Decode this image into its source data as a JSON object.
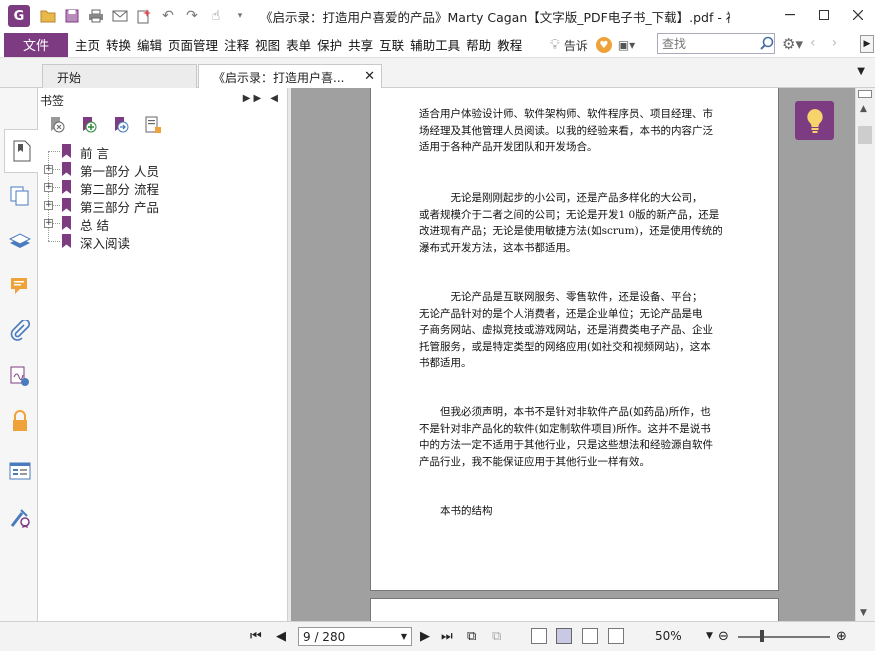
{
  "titlebar": {
    "app_logo": "G",
    "title": "《启示录：打造用户喜爱的产品》Marty Cagan【文字版_PDF电子书_下载】.pdf - 福昕...",
    "window_controls": [
      "minimize",
      "restore",
      "close"
    ]
  },
  "menubar": {
    "file_label": "文件",
    "items": [
      "主页",
      "转换",
      "编辑",
      "页面管理",
      "注释",
      "视图",
      "表单",
      "保护",
      "共享",
      "互联",
      "辅助工具",
      "帮助",
      "教程"
    ],
    "tell_label": "告诉",
    "search_placeholder": "查找"
  },
  "tabs": [
    {
      "label": "开始"
    },
    {
      "label": "《启示录：打造用户喜...",
      "active": true
    }
  ],
  "bookmarks": {
    "header": "书签",
    "items": [
      {
        "label": "前 言",
        "expandable": false
      },
      {
        "label": "第一部分 人员",
        "expandable": true
      },
      {
        "label": "第二部分 流程",
        "expandable": true
      },
      {
        "label": "第三部分 产品",
        "expandable": true
      },
      {
        "label": "总 结",
        "expandable": true
      },
      {
        "label": "深入阅读",
        "expandable": false
      }
    ]
  },
  "document": {
    "paragraphs": [
      [
        "适合用户体验设计师、软件架构师、软件程序员、项目经理、市",
        "场经理及其他管理人员阅读。以我的经验来看，本书的内容广泛",
        "适用于各种产品开发团队和开发场合。"
      ],
      [
        "　　　无论是刚刚起步的小公司，还是产品多样化的大公司，",
        "或者规模介于二者之间的公司；无论是开发1 0版的新产品，还是",
        "改进现有产品；无论是使用敏捷方法(如scrum)，还是使用传统的",
        "瀑布式开发方法，这本书都适用。"
      ],
      [
        "　　　无论产品是互联网服务、零售软件，还是设备、平台；",
        "无论产品针对的是个人消费者，还是企业单位；无论产品是电",
        "子商务网站、虚拟竞技或游戏网站，还是消费类电子产品、企业",
        "托管服务，或是特定类型的网络应用(如社交和视频网站)，这本",
        "书都适用。"
      ],
      [
        "　　但我必须声明，本书不是针对非软件产品(如药品)所作，也",
        "不是针对非产品化的软件(如定制软件项目)所作。这并不是说书",
        "中的方法一定不适用于其他行业，只是这些想法和经验源自软件",
        "产品行业，我不能保证应用于其他行业一样有效。"
      ],
      [
        "　　本书的结构"
      ]
    ]
  },
  "statusbar": {
    "page_value": "9 / 280",
    "zoom": "50%"
  },
  "colors": {
    "accent": "#7d3c82",
    "doc_background": "#a0a0a0"
  }
}
